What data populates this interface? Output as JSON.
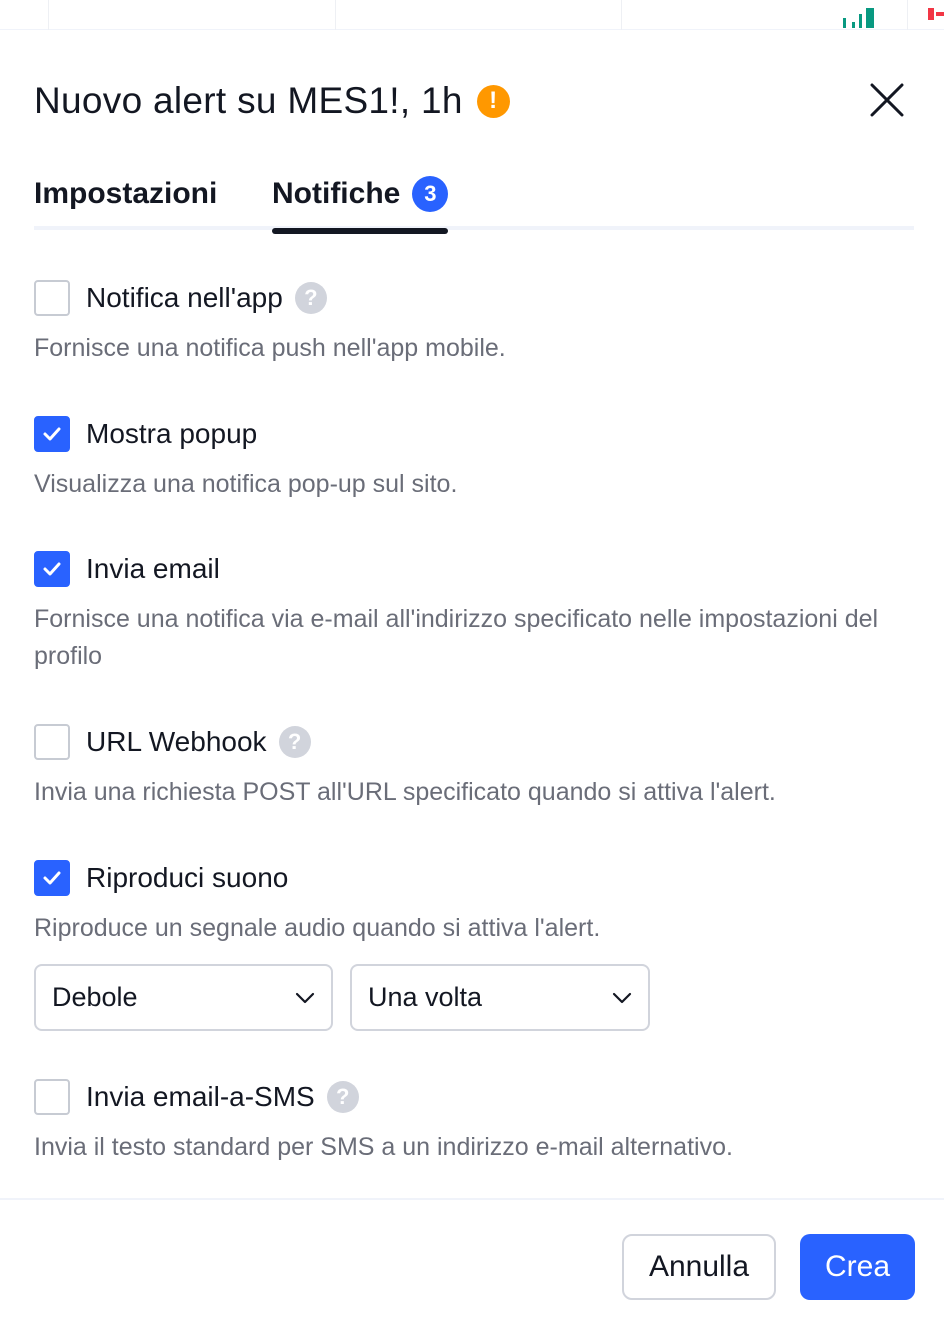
{
  "dialog": {
    "title": "Nuovo alert su MES1!, 1h",
    "warning_icon": "exclamation-icon",
    "close_icon": "close-icon"
  },
  "tabs": [
    {
      "label": "Impostazioni",
      "active": false
    },
    {
      "label": "Notifiche",
      "active": true,
      "badge": "3"
    }
  ],
  "options": [
    {
      "label": "Notifica nell'app",
      "checked": false,
      "help": true,
      "description": "Fornisce una notifica push nell'app mobile."
    },
    {
      "label": "Mostra popup",
      "checked": true,
      "help": false,
      "description": "Visualizza una notifica pop-up sul sito."
    },
    {
      "label": "Invia email",
      "checked": true,
      "help": false,
      "description": "Fornisce una notifica via e-mail all'indirizzo specificato nelle impostazioni del profilo"
    },
    {
      "label": "URL Webhook",
      "checked": false,
      "help": true,
      "description": "Invia una richiesta POST all'URL specificato quando si attiva l'alert."
    },
    {
      "label": "Riproduci suono",
      "checked": true,
      "help": false,
      "description": "Riproduce un segnale audio quando si attiva l'alert."
    },
    {
      "label": "Invia email-a-SMS",
      "checked": false,
      "help": true,
      "description": "Invia il testo standard per SMS a un indirizzo e-mail alternativo."
    }
  ],
  "sound": {
    "volume_selected": "Debole",
    "repeat_selected": "Una volta"
  },
  "footer": {
    "cancel_label": "Annulla",
    "create_label": "Crea"
  },
  "colors": {
    "accent": "#2962ff",
    "warning": "#ff9800",
    "text": "#131722",
    "muted": "#6a6d78"
  }
}
